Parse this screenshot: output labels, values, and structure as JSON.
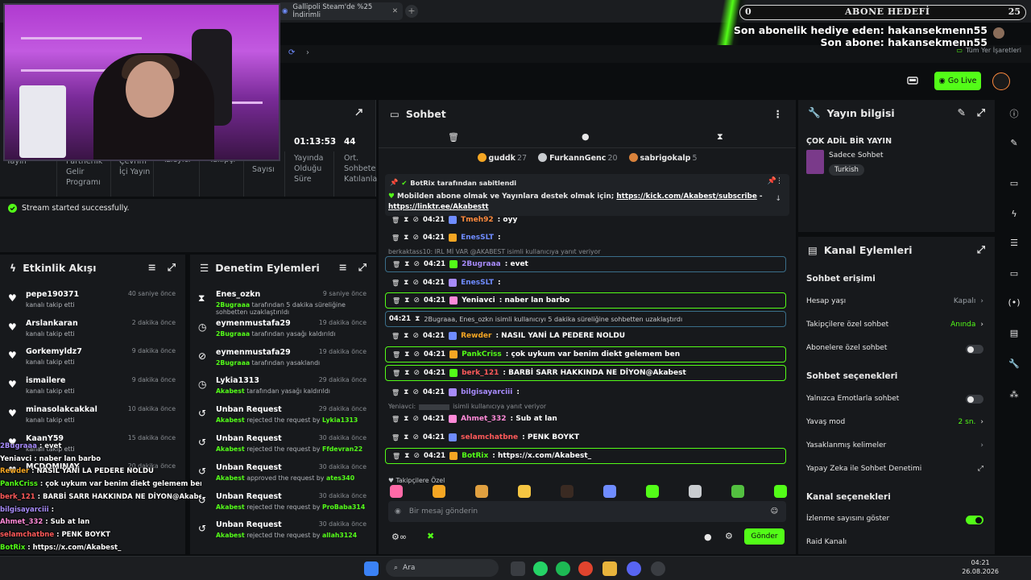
{
  "browser": {
    "tab_title": "Gallipoli Steam'de %25 İndirimli",
    "bookmark_label": "Tüm Yer İşaretleri"
  },
  "overlay": {
    "goal_left": "0",
    "goal_title": "ABONE HEDEFİ",
    "goal_right": "25",
    "gift_sub_line": "Son abonelik hediye eden: hakansekmenn55",
    "last_sub_line": "Son abone: hakansekmenn55"
  },
  "toolbar": {
    "go_live_label": "Go Live"
  },
  "stats": {
    "cells": [
      {
        "label": "Yayın",
        "value": ""
      },
      {
        "label": "Partnerlik Gelir Programı",
        "value": ""
      },
      {
        "label": "Çevrim İçi Yayın",
        "value": ""
      },
      {
        "label": "İzleyici",
        "value": ""
      },
      {
        "label": "Takipçi",
        "value": ""
      },
      {
        "label": "Sayısı",
        "value": ""
      },
      {
        "label": "Yayında Olduğu Süre",
        "value": "01:13:53"
      },
      {
        "label": "Ort. Sohbete Katılanla",
        "value": "44"
      }
    ],
    "toast": "Stream started successfully."
  },
  "activity": {
    "title": "Etkinlik Akışı",
    "items": [
      {
        "name": "pepe190371",
        "sub": "kanalı takip etti",
        "time": "40 saniye önce"
      },
      {
        "name": "Arslankaran",
        "sub": "kanalı takip etti",
        "time": "2 dakika önce"
      },
      {
        "name": "Gorkemyldz7",
        "sub": "kanalı takip etti",
        "time": "9 dakika önce"
      },
      {
        "name": "ismailere",
        "sub": "kanalı takip etti",
        "time": "9 dakika önce"
      },
      {
        "name": "minasolakcakkal",
        "sub": "kanalı takip etti",
        "time": "10 dakika önce"
      },
      {
        "name": "KaanY59",
        "sub": "kanalı takip etti",
        "time": "15 dakika önce"
      },
      {
        "name": "MCDOMINAY",
        "sub": "",
        "time": "20 dakika önce"
      }
    ]
  },
  "audit": {
    "title": "Denetim Eylemleri",
    "items": [
      {
        "icon": "hourglass",
        "name": "Enes_ozkn",
        "actor": "2Bugraaa",
        "sub": " tarafından 5 dakika süreliğine sohbetten uzaklaştırıldı",
        "target": "",
        "time": "9 saniye önce"
      },
      {
        "icon": "clock",
        "name": "eymenmustafa29",
        "actor": "2Bugraaa",
        "sub": " tarafından yasağı kaldırıldı",
        "target": "",
        "time": "19 dakika önce"
      },
      {
        "icon": "ban",
        "name": "eymenmustafa29",
        "actor": "2Bugraaa",
        "sub": " tarafından yasaklandı",
        "target": "",
        "time": "19 dakika önce"
      },
      {
        "icon": "clock",
        "name": "Lykia1313",
        "actor": "Akabest",
        "sub": " tarafından yasağı kaldırıldı",
        "target": "",
        "time": "29 dakika önce"
      },
      {
        "icon": "unban",
        "name": "Unban Request",
        "actor": "Akabest",
        "sub": " rejected the request by ",
        "target": "Lykia1313",
        "time": "29 dakika önce"
      },
      {
        "icon": "unban",
        "name": "Unban Request",
        "actor": "Akabest",
        "sub": " rejected the request by ",
        "target": "Ffdevran22",
        "time": "30 dakika önce"
      },
      {
        "icon": "unban",
        "name": "Unban Request",
        "actor": "Akabest",
        "sub": " approved the request by ",
        "target": "ates340",
        "time": "30 dakika önce"
      },
      {
        "icon": "unban",
        "name": "Unban Request",
        "actor": "Akabest",
        "sub": " rejected the request by ",
        "target": "ProBaba314",
        "time": "30 dakika önce"
      },
      {
        "icon": "unban",
        "name": "Unban Request",
        "actor": "Akabest",
        "sub": " rejected the request by ",
        "target": "allah3124",
        "time": "30 dakika önce"
      }
    ]
  },
  "overlay_chat": [
    {
      "user": "2Bugraaa",
      "color": "#a78bfa",
      "text": " : evet"
    },
    {
      "user": "Yeniavci",
      "color": "#ffffff",
      "text": " : naber lan barbo"
    },
    {
      "user": "Rewder",
      "color": "#f5a623",
      "text": " : NASIL YANİ LA PEDERE NOLDU"
    },
    {
      "user": "PankCriss",
      "color": "#53fc18",
      "text": " : çok uykum var benim diekt gelemem ben"
    },
    {
      "user": "berk_121",
      "color": "#ff5a5a",
      "text": " : BARBİ SARR HAKKINDA NE DİYON@Akabest"
    },
    {
      "user": "bilgisayarciii",
      "color": "#a78bfa",
      "text": " : "
    },
    {
      "user": "Ahmet_332",
      "color": "#ff8ad8",
      "text": " : Sub at lan"
    },
    {
      "user": "selamchatbne",
      "color": "#ff5a5a",
      "text": " : PENK BOYKT"
    },
    {
      "user": "BotRix",
      "color": "#53fc18",
      "text": " : https://x.com/Akabest_"
    }
  ],
  "chat": {
    "title": "Sohbet",
    "leaders": [
      {
        "name": "guddk",
        "count": "27",
        "color": "#f5a623"
      },
      {
        "name": "FurkannGenc",
        "count": "20",
        "color": "#c9ccd0"
      },
      {
        "name": "sabrigokalp",
        "count": "5",
        "color": "#d9823b"
      }
    ],
    "pinned_by": "BotRix tarafından sabitlendi",
    "pinned_text": "Mobilden abone olmak ve Yayınlara destek olmak için;",
    "pinned_link1": "https://kick.com/Akabest/subscribe",
    "pinned_link2": "https://linktr.ee/Akabestt",
    "messages": [
      {
        "time": "04:21",
        "user": "Tmeh92",
        "ucolor": "#ff8a3d",
        "text": ": oyy"
      },
      {
        "time": "04:21",
        "user": "EnesSLT",
        "ucolor": "#6f8cff",
        "text": ":"
      },
      {
        "time": "04:21",
        "user": "2Bugraaa",
        "ucolor": "#a78bfa",
        "text": ": evet"
      },
      {
        "time": "04:21",
        "user": "EnesSLT",
        "ucolor": "#6f8cff",
        "text": ":"
      },
      {
        "time": "04:21",
        "user": "Yeniavci",
        "ucolor": "#ffffff",
        "text": ": naber lan barbo"
      },
      {
        "time": "04:21",
        "user": "Rewder",
        "ucolor": "#f5a623",
        "text": ": NASIL YANİ LA PEDERE NOLDU"
      },
      {
        "time": "04:21",
        "user": "PankCriss",
        "ucolor": "#53fc18",
        "text": ": çok uykum var benim diekt gelemem ben"
      },
      {
        "time": "04:21",
        "user": "berk_121",
        "ucolor": "#ff5a5a",
        "text": ": BARBİ SARR HAKKINDA NE DİYON@Akabest"
      },
      {
        "time": "04:21",
        "user": "bilgisayarciii",
        "ucolor": "#a78bfa",
        "text": ":"
      },
      {
        "time": "04:21",
        "user": "Ahmet_332",
        "ucolor": "#ff8ad8",
        "text": ": Sub at lan"
      },
      {
        "time": "04:21",
        "user": "selamchatbne",
        "ucolor": "#ff5a5a",
        "text": ": PENK BOYKT"
      },
      {
        "time": "04:21",
        "user": "BotRix",
        "ucolor": "#53fc18",
        "text": ": https://x.com/Akabest_"
      }
    ],
    "reply1": "berkaktass10: IRL Mİ VAR @AKABEST isimli kullanıcıya yanıt veriyor",
    "system_time": "04:21",
    "system_text": "2Bugraaa, Enes_ozkn isimli kullanıcıyı 5 dakika süreliğine sohbetten uzaklaştırdı",
    "reply2_a": "Yeniavci:",
    "reply2_b": "isimli kullanıcıya yanıt veriyor",
    "followers_only": "Takipçilere Özel",
    "input_placeholder": "Bir mesaj gönderin",
    "send_label": "Gönder"
  },
  "stream_info": {
    "title": "Yayın bilgisi",
    "stream_title": "ÇOK ADİL BİR YAYIN",
    "category": "Sadece Sohbet",
    "language": "Turkish"
  },
  "channel_actions": {
    "title": "Kanal Eylemleri",
    "chat_access": "Sohbet erişimi",
    "account_age": "Hesap yaşı",
    "account_age_val": "Kapalı",
    "followers_chat": "Takipçilere özel sohbet",
    "followers_chat_val": "Anında",
    "subs_chat": "Abonelere özel sohbet",
    "chat_options": "Sohbet seçenekleri",
    "emote_only": "Yalnızca Emotlarla sohbet",
    "slow_mode": "Yavaş mod",
    "slow_mode_val": "2 sn.",
    "banned_words": "Yasaklanmış kelimeler",
    "ai_mod": "Yapay Zeka ile Sohbet Denetimi",
    "channel_options": "Kanal seçenekleri",
    "show_viewers": "İzlenme sayısını göster",
    "raid": "Raid Kanalı"
  },
  "taskbar": {
    "search": "Ara",
    "time": "04:21",
    "date": "26.08.2026"
  }
}
